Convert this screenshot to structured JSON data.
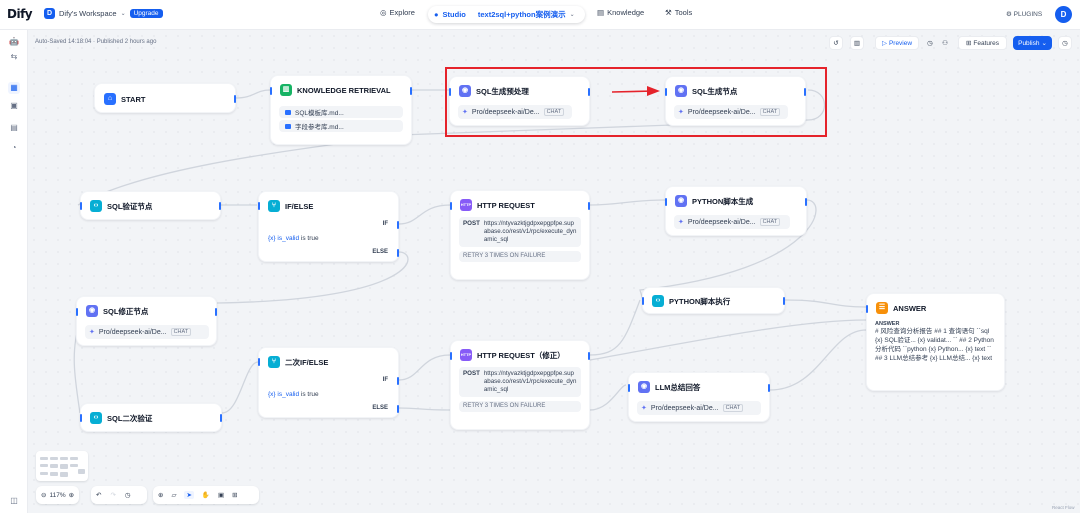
{
  "app": {
    "logo": "Dify",
    "workspace": "Dify's Workspace",
    "workspace_initial": "D",
    "upgrade": "Upgrade"
  },
  "nav": {
    "explore": "Explore",
    "studio": "Studio",
    "app_name": "text2sql+python案例演示",
    "knowledge": "Knowledge",
    "tools": "Tools",
    "plugins": "PLUGINS",
    "user_initial": "D"
  },
  "status": {
    "autosaved": "Auto-Saved 14:18:04 · Published 2 hours ago"
  },
  "toolbar": {
    "preview": "Preview",
    "features": "Features",
    "publish": "Publish"
  },
  "nodes": {
    "start": {
      "title": "START"
    },
    "kr": {
      "title": "KNOWLEDGE RETRIEVAL",
      "items": [
        "SQL模板库.md...",
        "字段参考库.md..."
      ]
    },
    "sql_pre": {
      "title": "SQL生成预处理",
      "model": "Pro/deepseek-ai/De...",
      "tag": "CHAT"
    },
    "sql_gen": {
      "title": "SQL生成节点",
      "model": "Pro/deepseek-ai/De...",
      "tag": "CHAT"
    },
    "sql_verify": {
      "title": "SQL验证节点"
    },
    "ifelse1": {
      "title": "IF/ELSE",
      "if_label": "IF",
      "else_label": "ELSE",
      "var": "{x}  is_valid",
      "op": "is true"
    },
    "http1": {
      "title": "HTTP REQUEST",
      "method": "POST",
      "url": "https://ntyvazktjgdpxepgpfpe.supabase.co/rest/v1/rpc/execute_dynamic_sql",
      "retry": "RETRY 3 TIMES ON FAILURE"
    },
    "py_gen": {
      "title": "PYTHON脚本生成",
      "model": "Pro/deepseek-ai/De...",
      "tag": "CHAT"
    },
    "sql_fix": {
      "title": "SQL修正节点",
      "model": "Pro/deepseek-ai/De...",
      "tag": "CHAT"
    },
    "py_exec": {
      "title": "PYTHON脚本执行"
    },
    "answer": {
      "title": "ANSWER",
      "label": "ANSWER",
      "body": "# 风险查询分析报告 ## 1 查询语句 ``sql {x} SQL验证... {x} validat... `` ## 2 Python分析代码 ``python {x} Python... {x} text `` ## 3 LLM总结参考 {x} LLM总结... {x} text"
    },
    "ifelse2": {
      "title": "二次IF/ELSE",
      "if_label": "IF",
      "else_label": "ELSE",
      "var": "{x}  is_valid",
      "op": "is true"
    },
    "http2": {
      "title": "HTTP REQUEST（修正）",
      "method": "POST",
      "url": "https://ntyvazktjgdpxepgpfpe.supabase.co/rest/v1/rpc/execute_dynamic_sql",
      "retry": "RETRY 3 TIMES ON FAILURE"
    },
    "sql_verify2": {
      "title": "SQL二次验证"
    },
    "llm_sum": {
      "title": "LLM总结回答",
      "model": "Pro/deepseek-ai/De...",
      "tag": "CHAT"
    }
  },
  "zoom": {
    "level": "117%"
  },
  "footer": {
    "reactflow": "React Flow"
  },
  "colors": {
    "accent": "#155eef",
    "highlight": "#e5232b"
  }
}
